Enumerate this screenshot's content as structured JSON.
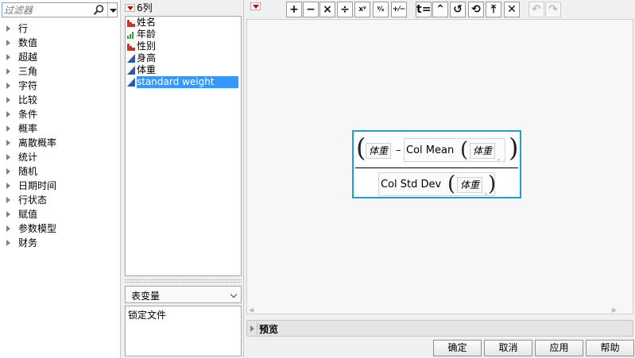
{
  "filter": {
    "placeholder": "过滤器",
    "icon": "search-icon"
  },
  "categories": [
    "行",
    "数值",
    "超越",
    "三角",
    "字符",
    "比较",
    "条件",
    "概率",
    "离散概率",
    "统计",
    "随机",
    "日期时间",
    "行状态",
    "赋值",
    "参数模型",
    "财务"
  ],
  "columns": {
    "count_label": "6列",
    "items": [
      {
        "name": "姓名",
        "type": "nominal",
        "selected": false
      },
      {
        "name": "年龄",
        "type": "ordinal",
        "selected": false
      },
      {
        "name": "性别",
        "type": "nominal",
        "selected": false
      },
      {
        "name": "身高",
        "type": "continuous",
        "selected": false
      },
      {
        "name": "体重",
        "type": "continuous",
        "selected": false
      },
      {
        "name": "standard weight",
        "type": "continuous",
        "selected": true
      }
    ]
  },
  "table_variable": {
    "selected": "表变量"
  },
  "lock_file": "锁定文件",
  "toolbar": {
    "buttons": [
      "+",
      "−",
      "×",
      "÷",
      "xʸ",
      "ʸ⁄ₓ",
      "+⁄−",
      "t=",
      "⌃",
      "↺",
      "⟲",
      "⤒",
      "✕",
      "↶",
      "↷"
    ]
  },
  "formula": {
    "numerator_var": "体重",
    "minus": "–",
    "mean_fn": "Col Mean",
    "mean_arg": "体重",
    "denominator_fn": "Col Std Dev",
    "denominator_arg": "体重",
    "accent_color": "#1ea0d0"
  },
  "preview": {
    "label": "预览"
  },
  "buttons": {
    "ok": "确定",
    "cancel": "取消",
    "apply": "应用",
    "help": "帮助"
  }
}
